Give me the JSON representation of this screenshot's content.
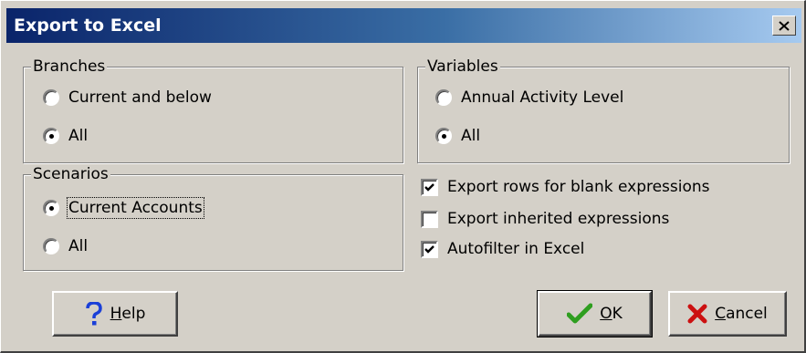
{
  "window": {
    "title": "Export to Excel"
  },
  "branches": {
    "legend": "Branches",
    "options": [
      {
        "label": "Current and below",
        "selected": false
      },
      {
        "label": "All",
        "selected": true
      }
    ]
  },
  "variables": {
    "legend": "Variables",
    "options": [
      {
        "label": "Annual Activity Level",
        "selected": false
      },
      {
        "label": "All",
        "selected": true
      }
    ]
  },
  "scenarios": {
    "legend": "Scenarios",
    "options": [
      {
        "label": "Current Accounts",
        "selected": true
      },
      {
        "label": "All",
        "selected": false
      }
    ]
  },
  "checkboxes": [
    {
      "label": "Export rows for blank expressions",
      "checked": true
    },
    {
      "label": "Export inherited expressions",
      "checked": false
    },
    {
      "label": "Autofilter in Excel",
      "checked": true
    }
  ],
  "buttons": {
    "help": {
      "mnemonic": "H",
      "rest": "elp",
      "icon": "question-icon"
    },
    "ok": {
      "mnemonic": "O",
      "rest": "K",
      "icon": "checkmark-icon"
    },
    "cancel": {
      "mnemonic": "C",
      "rest": "ancel",
      "icon": "x-icon"
    }
  },
  "colors": {
    "titlebar_start": "#0a246a",
    "titlebar_end": "#a6caf0",
    "face": "#d4d0c8",
    "ok_icon": "#2e9e1f",
    "cancel_icon": "#cc1010",
    "help_icon": "#1a3fd8"
  }
}
